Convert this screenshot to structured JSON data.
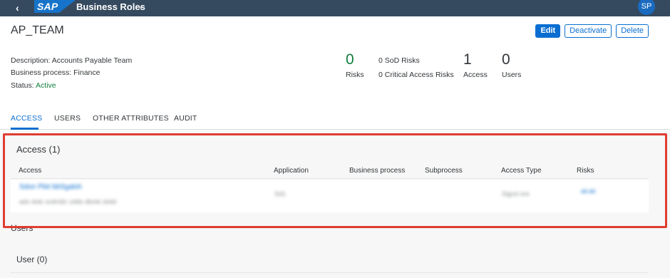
{
  "shell": {
    "back_icon": "‹",
    "title": "Business Roles",
    "chevron": "⌄",
    "logo_text": "SAP",
    "avatar": "SP"
  },
  "header": {
    "title": "AP_TEAM",
    "actions": {
      "edit": "Edit",
      "deactivate": "Deactivate",
      "delete": "Delete"
    },
    "description_label": "Description: ",
    "description": "Accounts Payable Team",
    "bp_label": "Business process: ",
    "bp": "Finance",
    "status_label": "Status: ",
    "status": "Active",
    "kpis": {
      "risks_value": "0",
      "risks_label": "Risks",
      "sod": "0 SoD Risks",
      "critical": "0 Critical Access Risks",
      "access_value": "1",
      "access_label": "Access",
      "users_value": "0",
      "users_label": "Users"
    }
  },
  "tabs": [
    "ACCESS",
    "USERS",
    "OTHER ATTRIBUTES",
    "AUDIT"
  ],
  "access_section": {
    "title": "Access (1)",
    "columns": [
      "Access",
      "Application",
      "Business process",
      "Subprocess",
      "Access Type",
      "Risks"
    ],
    "row_blurred": {
      "name": "Sdon Pbit bbSgalsh",
      "detail": "ads dsle  svdmibr  zdde dbnld  zbdd",
      "app": "Sd1",
      "type": "Signd ore",
      "risks": "dd.dd"
    }
  },
  "users_section": {
    "title": "Users",
    "sub_title": "User (0)"
  },
  "colors": {
    "shell": "#354a5f",
    "accent": "#0a6ed1",
    "positive": "#107e3e",
    "highlight": "#e03c31"
  }
}
